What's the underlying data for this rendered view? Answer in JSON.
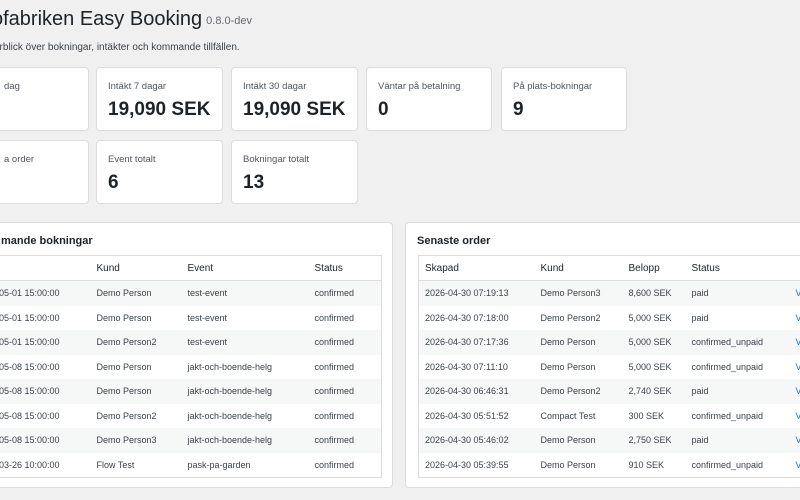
{
  "header": {
    "title": "ofabriken Easy Booking",
    "version": "0.8.0-dev",
    "subtitle": "erblick över bokningar, intäkter och kommande tillfällen."
  },
  "stats": [
    {
      "label": "dag",
      "value": ""
    },
    {
      "label": "Intäkt 7 dagar",
      "value": "19,090 SEK"
    },
    {
      "label": "Intäkt 30 dagar",
      "value": "19,090 SEK"
    },
    {
      "label": "Väntar på betalning",
      "value": "0"
    },
    {
      "label": "På plats-bokningar",
      "value": "9"
    },
    {
      "label": "a order",
      "value": ""
    },
    {
      "label": "Event totalt",
      "value": "6"
    },
    {
      "label": "Bokningar totalt",
      "value": "13"
    }
  ],
  "bookings": {
    "title": "mande bokningar",
    "columns": [
      "",
      "Kund",
      "Event",
      "Status"
    ],
    "rows": [
      [
        "-05-01 15:00:00",
        "Demo Person",
        "test-event",
        "confirmed"
      ],
      [
        "-05-01 15:00:00",
        "Demo Person",
        "test-event",
        "confirmed"
      ],
      [
        "-05-01 15:00:00",
        "Demo Person2",
        "test-event",
        "confirmed"
      ],
      [
        "-05-08 15:00:00",
        "Demo Person",
        "jakt-och-boende-helg",
        "confirmed"
      ],
      [
        "-05-08 15:00:00",
        "Demo Person",
        "jakt-och-boende-helg",
        "confirmed"
      ],
      [
        "-05-08 15:00:00",
        "Demo Person2",
        "jakt-och-boende-helg",
        "confirmed"
      ],
      [
        "-05-08 15:00:00",
        "Demo Person3",
        "jakt-och-boende-helg",
        "confirmed"
      ],
      [
        "-03-26 10:00:00",
        "Flow Test",
        "pask-pa-garden",
        "confirmed"
      ]
    ]
  },
  "orders": {
    "title": "Senaste order",
    "columns": [
      "Skapad",
      "Kund",
      "Belopp",
      "Status",
      ""
    ],
    "rows": [
      [
        "2026-04-30 07:19:13",
        "Demo Person3",
        "8,600 SEK",
        "paid",
        "V"
      ],
      [
        "2026-04-30 07:18:00",
        "Demo Person2",
        "5,000 SEK",
        "paid",
        "V"
      ],
      [
        "2026-04-30 07:17:36",
        "Demo Person",
        "5,000 SEK",
        "confirmed_unpaid",
        "V"
      ],
      [
        "2026-04-30 07:11:10",
        "Demo Person",
        "5,000 SEK",
        "confirmed_unpaid",
        "V"
      ],
      [
        "2026-04-30 06:46:31",
        "Demo Person2",
        "2,740 SEK",
        "paid",
        "V"
      ],
      [
        "2026-04-30 05:51:52",
        "Compact Test",
        "300 SEK",
        "confirmed_unpaid",
        "V"
      ],
      [
        "2026-04-30 05:46:02",
        "Demo Person",
        "2,750 SEK",
        "paid",
        "V"
      ],
      [
        "2026-04-30 05:39:55",
        "Demo Person",
        "910 SEK",
        "confirmed_unpaid",
        "V"
      ]
    ]
  },
  "colors": {
    "link": "#2271b1",
    "background": "#f0f0f1"
  }
}
